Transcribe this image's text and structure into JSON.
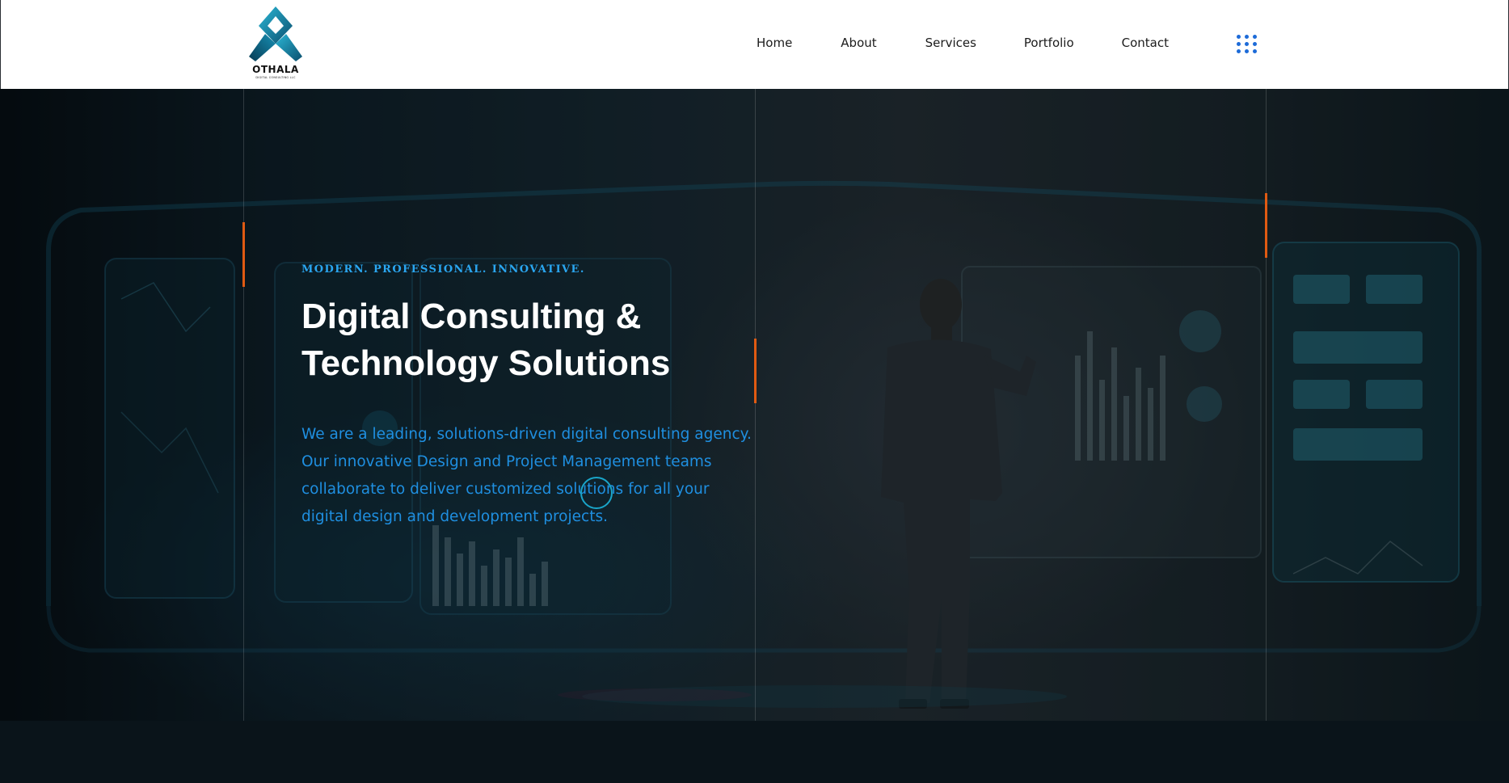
{
  "brand": {
    "name": "OTHALA",
    "tagline": "DIGITAL CONSULTING LLC",
    "logo_color": "#1593b6"
  },
  "nav": {
    "items": [
      {
        "label": "Home"
      },
      {
        "label": "About"
      },
      {
        "label": "Services"
      },
      {
        "label": "Portfolio"
      },
      {
        "label": "Contact"
      }
    ],
    "menu_icon": "grid-dots-icon",
    "menu_icon_color": "#1d6bd8"
  },
  "hero": {
    "eyebrow": "MODERN. PROFESSIONAL. INNOVATIVE.",
    "title_line1": "Digital Consulting &",
    "title_line2": "Technology Solutions",
    "description": "We are a leading, solutions-driven digital consulting agency. Our innovative Design and Project Management teams collaborate to deliver customized solutions for all your digital design and development projects.",
    "accent_color": "#e05a12",
    "text_color": "#1f8fe0",
    "eyebrow_color": "#2aa6f0"
  }
}
